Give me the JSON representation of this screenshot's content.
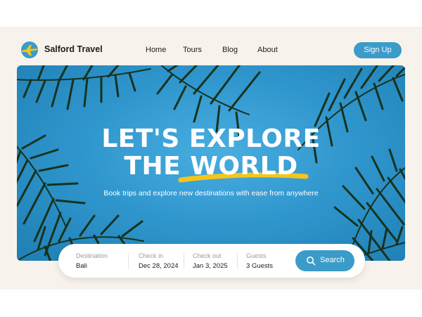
{
  "brand": {
    "name": "Salford Travel",
    "logo": "airplane-logo-icon"
  },
  "nav": {
    "items": [
      {
        "label": "Home"
      },
      {
        "label": "Tours"
      },
      {
        "label": "Blog"
      },
      {
        "label": "About"
      }
    ],
    "signup_label": "Sign Up"
  },
  "hero": {
    "headline_line1": "LET'S EXPLORE",
    "headline_line2": "THE WORLD",
    "subtitle": "Book trips and explore new destinations with ease from anywhere"
  },
  "search": {
    "fields": [
      {
        "label": "Destination",
        "value": "Bali"
      },
      {
        "label": "Check in",
        "value": "Dec 28, 2024"
      },
      {
        "label": "Check out",
        "value": "Jan 3, 2025"
      },
      {
        "label": "Guests",
        "value": "3 Guests"
      }
    ],
    "button_label": "Search",
    "button_icon": "search-icon"
  },
  "colors": {
    "accent": "#3b9bc9",
    "background": "#f8f2ec",
    "highlight": "#f5c518",
    "sky": "#2f96cd"
  }
}
